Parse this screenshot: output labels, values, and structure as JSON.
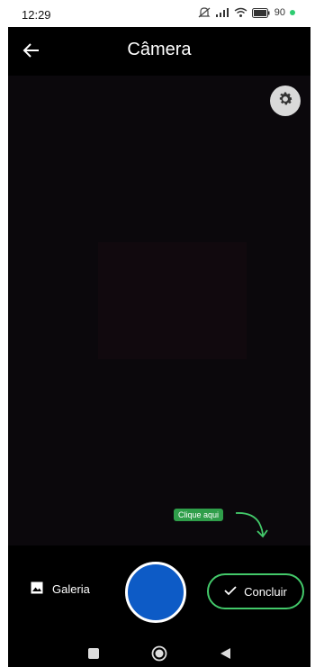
{
  "status_bar": {
    "time": "12:29",
    "battery_text": "90",
    "icons": [
      "mute-icon",
      "signal-icon",
      "wifi-icon",
      "battery-icon"
    ]
  },
  "app_bar": {
    "title": "Câmera",
    "back_icon": "arrow-left-icon"
  },
  "camera": {
    "settings_icon": "gear-icon"
  },
  "controls": {
    "gallery_label": "Galeria",
    "gallery_icon": "image-icon",
    "shutter_color": "#0d5bc6",
    "conclude_label": "Concluir",
    "conclude_icon": "check-icon",
    "conclude_border_color": "#43c96a"
  },
  "hint": {
    "text": "Clique aqui",
    "color": "#2f9e4a"
  },
  "nav_bar": {
    "buttons": [
      "recent-apps-icon",
      "home-icon",
      "back-triangle-icon"
    ]
  }
}
